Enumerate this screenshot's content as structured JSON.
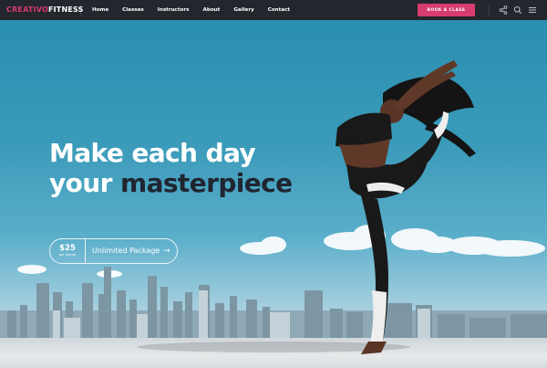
{
  "header": {
    "logo_part1": "CREATIVO",
    "logo_part2": "FITNESS",
    "nav": [
      "Home",
      "Classes",
      "Instructors",
      "About",
      "Gallery",
      "Contact"
    ],
    "cta_label": "BOOK A CLASS",
    "icons": [
      "share-icon",
      "search-icon",
      "menu-icon"
    ]
  },
  "hero": {
    "headline_line1": "Make each day",
    "headline_line2_a": "your",
    "headline_line2_b": "masterpiece",
    "package": {
      "price": "$25",
      "period": "per month",
      "name": "Unlimited Package",
      "arrow": "→"
    }
  },
  "colors": {
    "accent": "#d63c6f",
    "header_bg": "#24262d",
    "headline_dark": "#202530"
  }
}
